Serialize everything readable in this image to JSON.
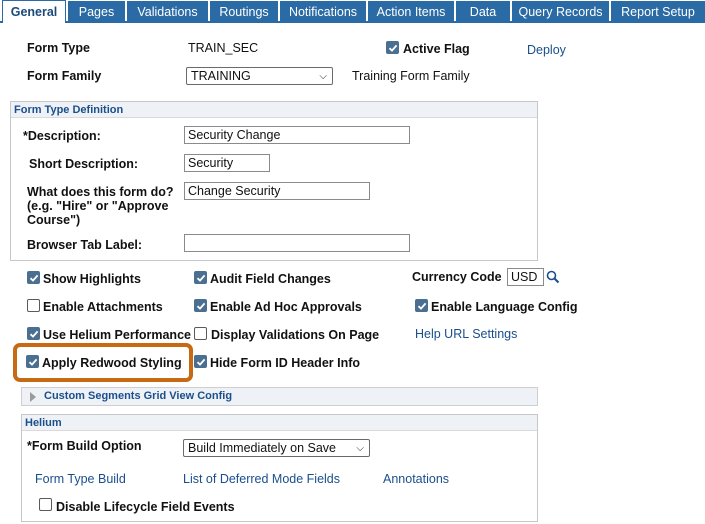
{
  "tabs": [
    "General",
    "Pages",
    "Validations",
    "Routings",
    "Notifications",
    "Action Items",
    "Data",
    "Query Records",
    "Report Setup"
  ],
  "header": {
    "form_type_label": "Form Type",
    "form_type_value": "TRAIN_SEC",
    "active_flag_label": "Active Flag",
    "deploy_link": "Deploy",
    "form_family_label": "Form Family",
    "form_family_value": "TRAINING",
    "form_family_desc": "Training Form Family"
  },
  "definition": {
    "title": "Form Type Definition",
    "description_label": "*Description:",
    "description_value": "Security Change",
    "short_desc_label": "Short Description:",
    "short_desc_value": "Security",
    "what_label_1": "What does this form do?",
    "what_label_2": "(e.g. \"Hire\" or \"Approve",
    "what_label_3": "Course\")",
    "what_value": "Change Security",
    "browser_tab_label": "Browser Tab Label:",
    "browser_tab_value": ""
  },
  "options": {
    "show_highlights": "Show Highlights",
    "audit_field_changes": "Audit Field Changes",
    "currency_code_label": "Currency Code",
    "currency_code_value": "USD",
    "enable_attachments": "Enable Attachments",
    "enable_adhoc": "Enable Ad Hoc Approvals",
    "enable_language": "Enable Language Config",
    "use_helium": "Use Helium Performance",
    "display_validations": "Display Validations On Page",
    "help_url": "Help URL Settings",
    "apply_redwood": "Apply Redwood Styling",
    "hide_form_id": "Hide Form ID Header Info"
  },
  "custom_segments": "Custom Segments Grid View Config",
  "helium": {
    "title": "Helium",
    "build_option_label": "*Form Build Option",
    "build_option_value": "Build Immediately on Save",
    "form_type_build_link": "Form Type Build",
    "deferred_fields_link": "List of Deferred Mode Fields",
    "annotations_link": "Annotations",
    "disable_lifecycle": "Disable Lifecycle Field Events"
  },
  "colors": {
    "tab_blue": "#2a6aa5",
    "checkbox_checked": "#4a6f91",
    "link_blue": "#1a4f8c",
    "highlight_orange": "#c86a13"
  }
}
